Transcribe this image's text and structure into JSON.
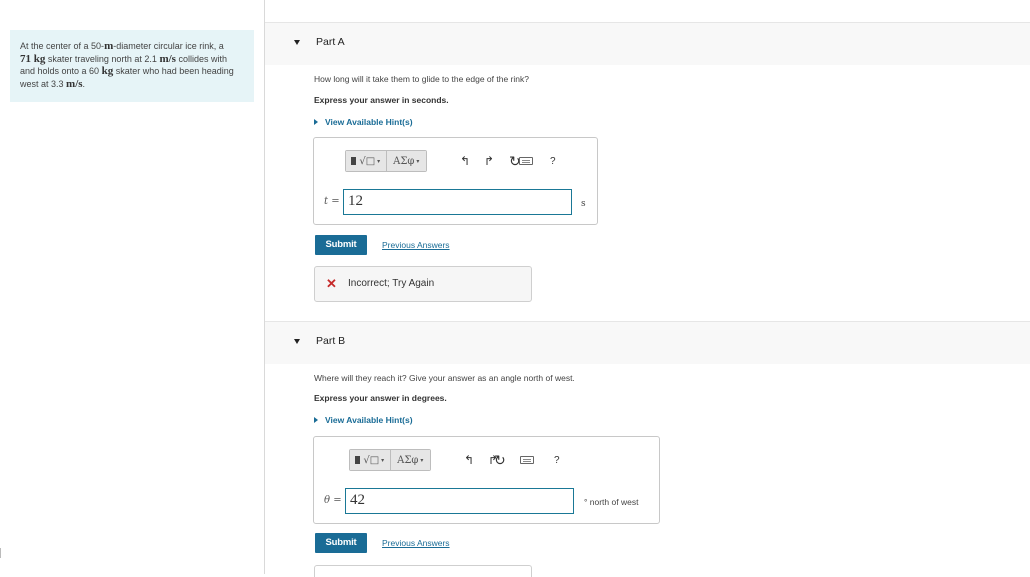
{
  "problem": {
    "t1": "At the center of a 50-",
    "u1": "m",
    "t2": "-diameter circular ice rink, a",
    "n1": "71 kg",
    "t3": " skater traveling north at 2.1 ",
    "u2": "m/s",
    "t4": " collides with and holds onto a 60 ",
    "u3": "kg",
    "t5": " skater who had been heading west at 3.3 ",
    "u4": "m/s",
    "t6": "."
  },
  "toolbar": {
    "templates_icon": "sqrt-template-icon",
    "greek_label": "ΑΣφ",
    "undo_icon": "undo-icon",
    "redo_icon": "redo-icon",
    "reset_icon": "reset-icon",
    "keyboard_icon": "keyboard-icon",
    "help_label": "?"
  },
  "partA": {
    "title": "Part A",
    "question": "How long will it take them to glide to the edge of the rink?",
    "express": "Express your answer in seconds.",
    "hint": "View Available Hint(s)",
    "variable": "t =",
    "value": "12",
    "unit": "s",
    "submit": "Submit",
    "previous": "Previous Answers",
    "feedback": "Incorrect; Try Again"
  },
  "partB": {
    "title": "Part B",
    "question": "Where will they reach it? Give your answer as an angle north of west.",
    "express": "Express your answer in degrees.",
    "hint": "View Available Hint(s)",
    "variable": "θ =",
    "value": "42",
    "unit": "° north of west",
    "submit": "Submit",
    "previous": "Previous Answers"
  },
  "colors": {
    "accent": "#1a6c96",
    "problem_bg": "#e6f4f7",
    "error": "#c62a2a"
  }
}
